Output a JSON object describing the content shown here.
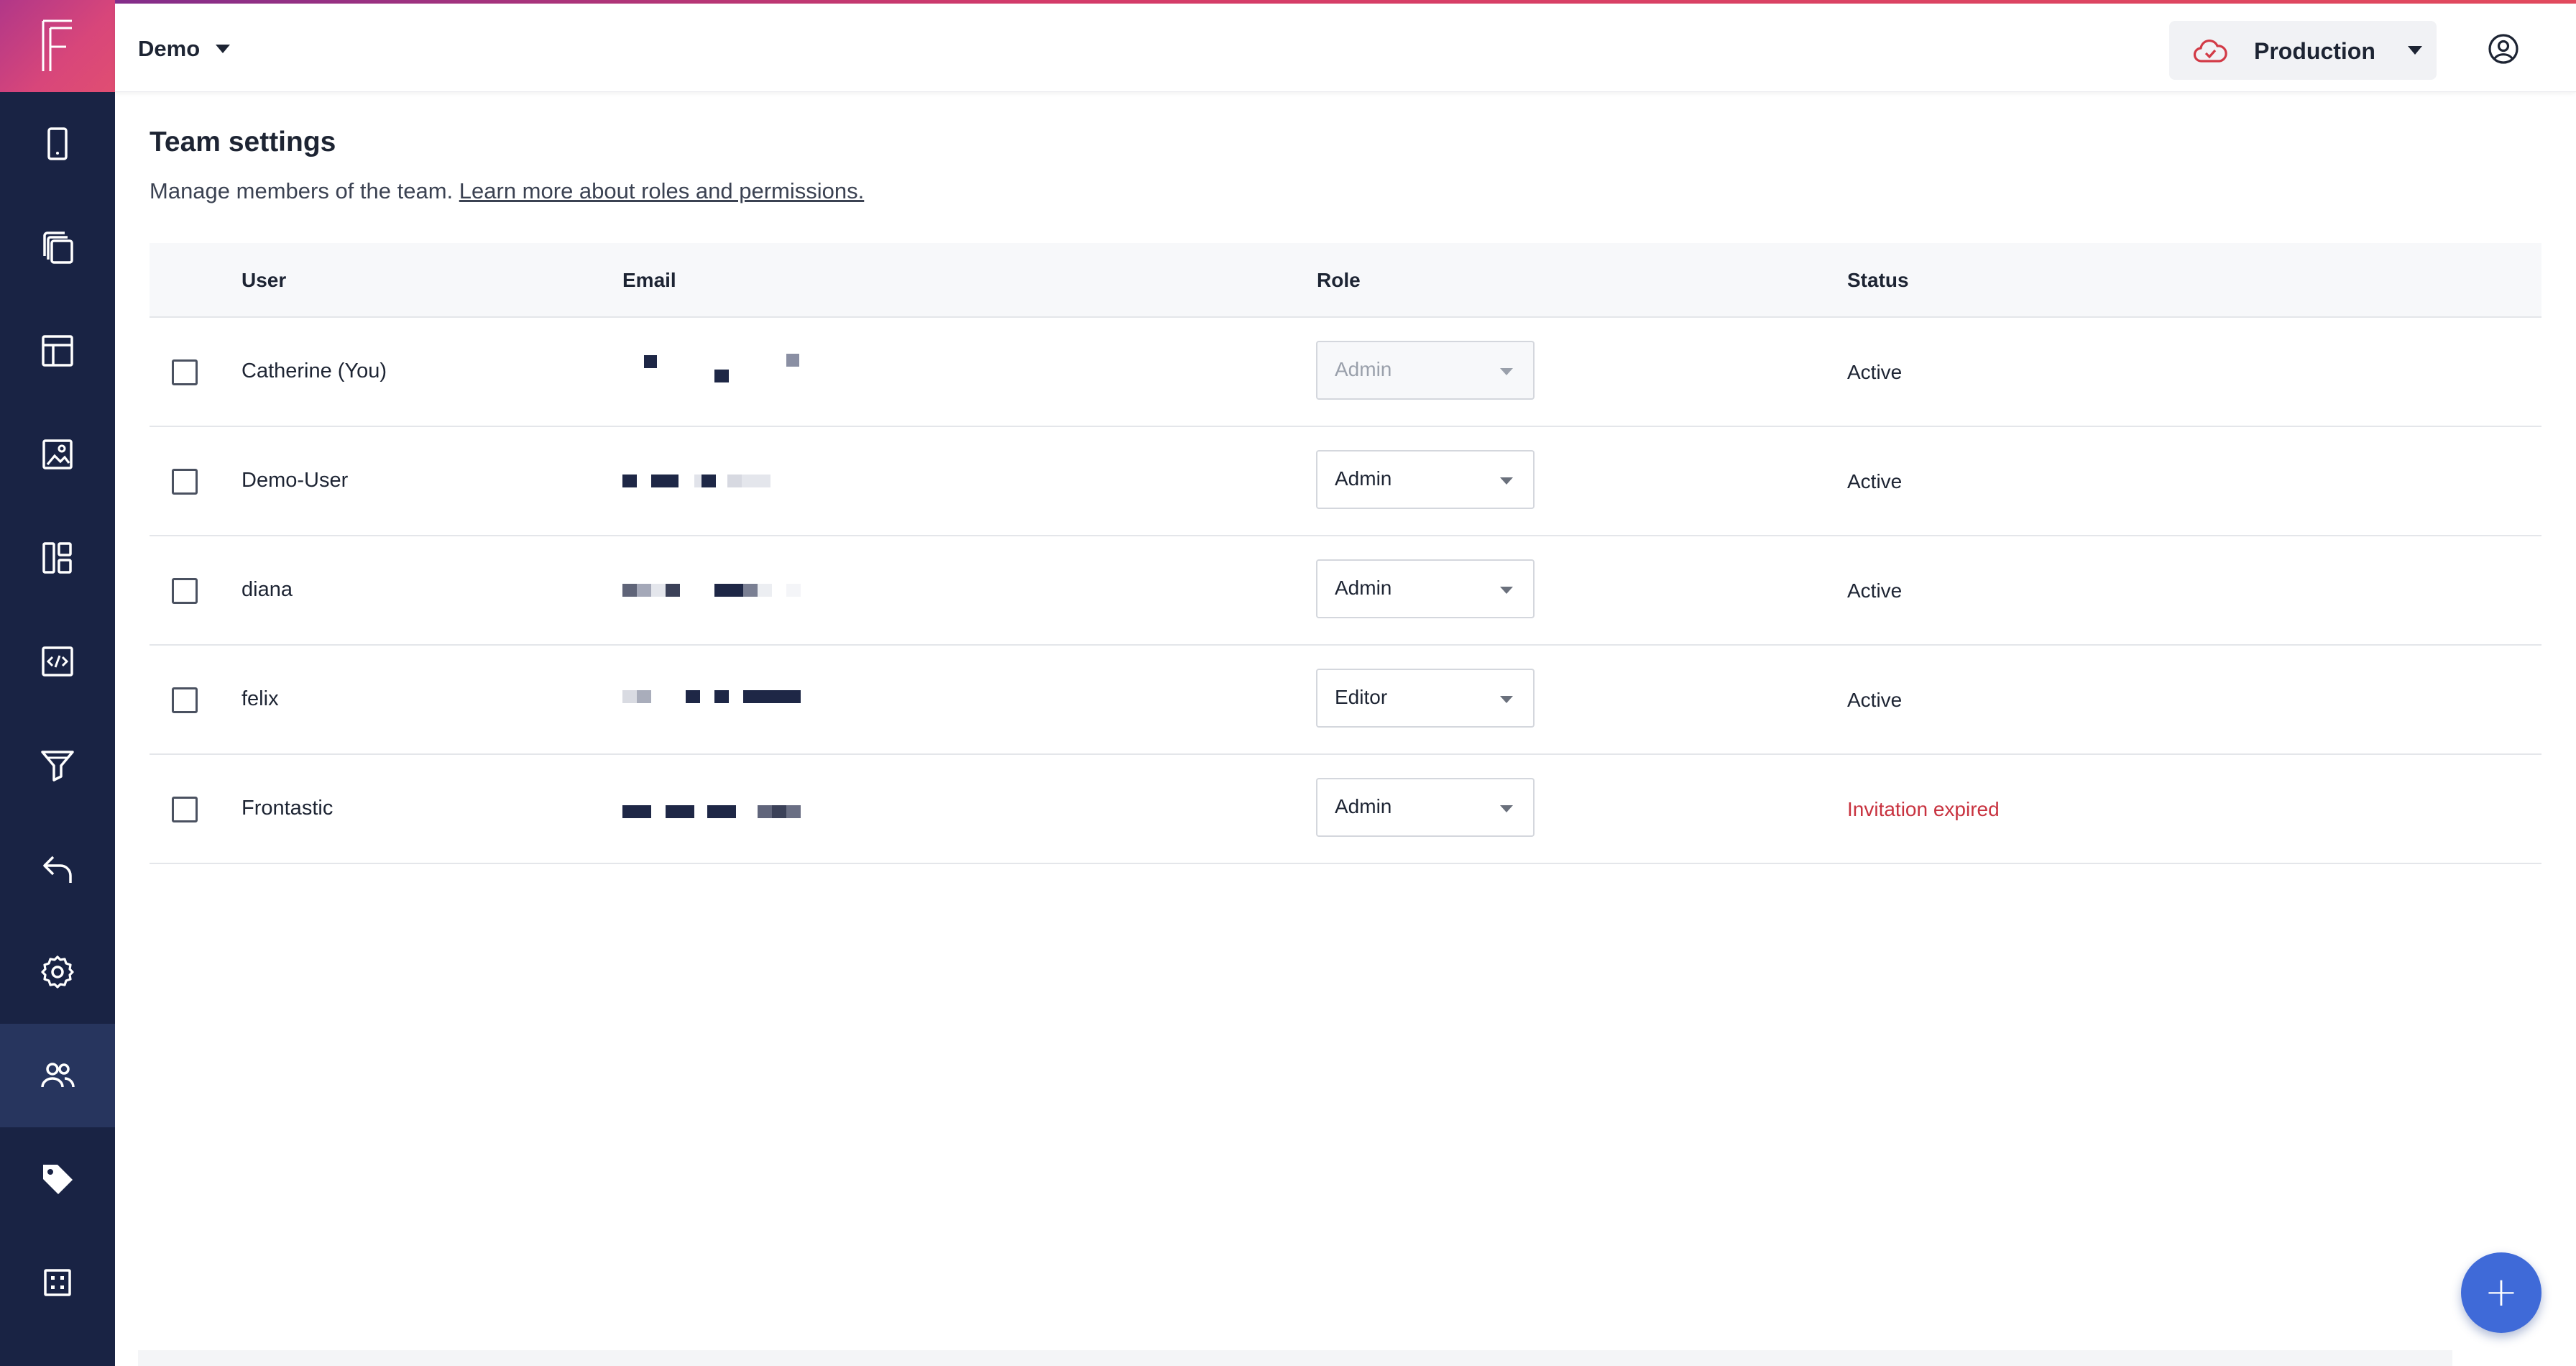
{
  "app": {
    "logo": "F"
  },
  "header": {
    "project": "Demo",
    "environment": "Production"
  },
  "sidebar": {
    "items": [
      {
        "name": "mobile-icon"
      },
      {
        "name": "copy-icon"
      },
      {
        "name": "layout-icon"
      },
      {
        "name": "image-icon"
      },
      {
        "name": "dashboard-icon"
      },
      {
        "name": "code-icon"
      },
      {
        "name": "funnel-icon"
      },
      {
        "name": "undo-icon"
      },
      {
        "name": "gear-icon"
      },
      {
        "name": "team-icon",
        "active": true
      },
      {
        "name": "tag-icon"
      },
      {
        "name": "grid-icon"
      }
    ]
  },
  "page": {
    "title": "Team settings",
    "description": "Manage members of the team.",
    "learn_more": "Learn more about roles and permissions."
  },
  "table": {
    "columns": [
      "User",
      "Email",
      "Role",
      "Status"
    ],
    "rows": [
      {
        "user": "Catherine (You)",
        "role": "Admin",
        "status": "Active",
        "role_disabled": true
      },
      {
        "user": "Demo-User",
        "role": "Admin",
        "status": "Active"
      },
      {
        "user": "diana",
        "role": "Admin",
        "status": "Active"
      },
      {
        "user": "felix",
        "role": "Editor",
        "status": "Active"
      },
      {
        "user": "Frontastic",
        "role": "Admin",
        "status": "Invitation expired"
      }
    ]
  },
  "fab": {
    "label": "+"
  },
  "colors": {
    "sidebar": "#192344",
    "accent": "#d8467a",
    "fab": "#3f6ad8",
    "expired": "#c8323f"
  }
}
